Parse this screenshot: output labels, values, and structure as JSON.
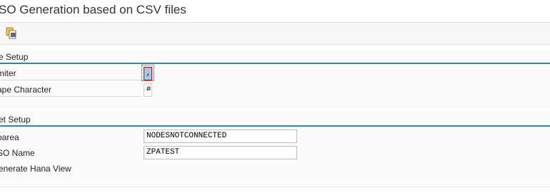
{
  "window": {
    "title": "SO Generation based on CSV files"
  },
  "toolbar": {
    "buttons": [
      {
        "name": "execute-icon"
      }
    ]
  },
  "sections": {
    "source": {
      "header": "e Setup",
      "delimiter_label": "miter",
      "delimiter_value": ",",
      "escape_label": "ape Character",
      "escape_value": "#"
    },
    "target": {
      "header": "et Setup",
      "infoarea_label": "oarea",
      "infoarea_value": "NODESNOTCONNECTED",
      "dso_label": "SO Name",
      "dso_value": "ZPATEST",
      "hana_view_label": "enerate Hana View"
    }
  },
  "colors": {
    "section_line": "#2e84b9",
    "focus_border": "#c40000",
    "focus_fill": "#a8c6e6"
  }
}
